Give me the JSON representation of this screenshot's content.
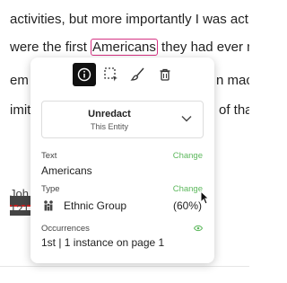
{
  "document": {
    "line1": "activities, but more importantly I was act",
    "line2_before": "were the first ",
    "line2_highlight": "Americans",
    "line2_after": " they had ever m",
    "line3_left": "em",
    "line3_right": "n mac",
    "line4_left": "imit",
    "line4_right": "of tha",
    "line5": "Joh",
    "line6": "121"
  },
  "popup": {
    "toolbar": {
      "info_icon": "info-icon",
      "select_icon": "area-select-icon",
      "brush_icon": "brush-icon",
      "delete_icon": "trash-icon"
    },
    "unredact": {
      "label": "Unredact",
      "sublabel": "This Entity"
    },
    "text_section": {
      "label": "Text",
      "change": "Change",
      "value": "Americans"
    },
    "type_section": {
      "label": "Type",
      "change": "Change",
      "value": "Ethnic Group",
      "confidence": "(60%)"
    },
    "occurrences_section": {
      "label": "Occurrences",
      "value": "1st | 1 instance on page 1"
    }
  },
  "colors": {
    "highlight_border": "#d63384",
    "change_link": "#5cb85c",
    "active_tool": "#111111"
  }
}
